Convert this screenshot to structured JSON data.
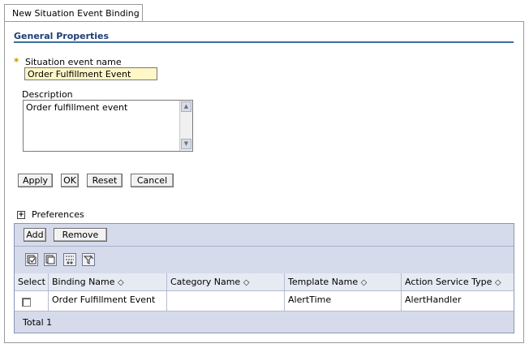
{
  "tab": {
    "label": "New Situation Event Binding"
  },
  "section": {
    "title": "General Properties"
  },
  "form": {
    "required_marker": "*",
    "name_label": "Situation event name",
    "name_value": "Order Fulfillment Event",
    "description_label": "Description",
    "description_value": "Order fulfillment event"
  },
  "buttons": {
    "apply": "Apply",
    "ok": "OK",
    "reset": "Reset",
    "cancel": "Cancel"
  },
  "preferences": {
    "label": "Preferences"
  },
  "table_toolbar": {
    "add": "Add",
    "remove": "Remove"
  },
  "table": {
    "columns": [
      "Select",
      "Binding Name",
      "Category Name",
      "Template Name",
      "Action Service Type"
    ],
    "sort_glyph": "◇",
    "rows": [
      {
        "binding_name": "Order Fulfillment Event",
        "category_name": "",
        "template_name": "AlertTime",
        "action_service_type": "AlertHandler"
      }
    ],
    "total": "Total 1"
  },
  "icons": [
    "select-all-icon",
    "deselect-all-icon",
    "show-filter-icon",
    "clear-filter-icon"
  ],
  "colors": {
    "accent": "#1f3d76",
    "table_bg": "#d5dbea",
    "input_highlight": "#fff7c8"
  }
}
